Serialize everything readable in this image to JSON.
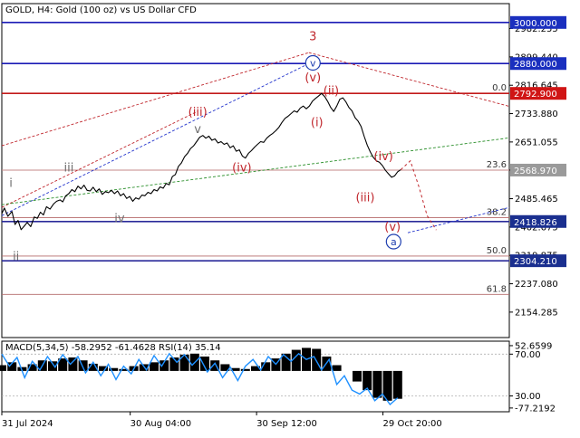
{
  "chart_data": {
    "type": "line",
    "title": "GOLD, H4:  Gold (100 oz) vs US Dollar CFD",
    "price_axis": {
      "ylim": [
        2080,
        3055
      ],
      "ticks": [
        "2982.255",
        "2899.440",
        "2816.645",
        "2733.880",
        "2651.055",
        "2568.970",
        "2485.465",
        "2402.675",
        "2319.875",
        "2237.080",
        "2154.285"
      ],
      "tick_values": [
        2982.255,
        2899.44,
        2816.645,
        2733.88,
        2651.055,
        2568.97,
        2485.465,
        2402.675,
        2319.875,
        2237.08,
        2154.285
      ]
    },
    "x_labels": [
      "31 Jul 2024",
      "30 Aug 04:00",
      "30 Sep 12:00",
      "29 Oct 20:00"
    ],
    "x_range": [
      0,
      100
    ],
    "x_label_positions": [
      0,
      25.3,
      50.2,
      75.1
    ],
    "levels": [
      {
        "name": "level-3000",
        "value": 3000.0,
        "label": "3000.000",
        "color": "#1a1ab5",
        "box": "#1a2fbf"
      },
      {
        "name": "level-2880",
        "value": 2880.0,
        "label": "2880.000",
        "color": "#1a1ab5",
        "box": "#1a2fbf"
      },
      {
        "name": "level-2792",
        "value": 2792.9,
        "label": "2792.900",
        "color": "#c21a1a",
        "box": "#d01515"
      },
      {
        "name": "level-2568",
        "value": 2568.97,
        "label": "2568.970",
        "color": "#c48a8a",
        "box": "#9a9a9a"
      },
      {
        "name": "level-2418",
        "value": 2418.826,
        "label": "2418.826",
        "color": "#2a2a9a",
        "box": "#1a2f8f"
      },
      {
        "name": "level-2304",
        "value": 2304.21,
        "label": "2304.210",
        "color": "#2a2a9a",
        "box": "#1a2f8f"
      }
    ],
    "fib_lines": [
      {
        "label": "0.0",
        "value": 2792.9
      },
      {
        "label": "23.6",
        "value": 2568.97
      },
      {
        "label": "38.2",
        "value": 2430.0
      },
      {
        "label": "50.0",
        "value": 2318.0
      },
      {
        "label": "61.8",
        "value": 2206.0
      }
    ],
    "price_series": [
      [
        0,
        2442
      ],
      [
        0.5,
        2458
      ],
      [
        1.2,
        2434
      ],
      [
        2,
        2448
      ],
      [
        2.6,
        2410
      ],
      [
        3.2,
        2422
      ],
      [
        3.8,
        2395
      ],
      [
        4.4,
        2405
      ],
      [
        5,
        2416
      ],
      [
        5.7,
        2404
      ],
      [
        6.4,
        2432
      ],
      [
        7,
        2428
      ],
      [
        7.6,
        2446
      ],
      [
        8.2,
        2438
      ],
      [
        8.8,
        2462
      ],
      [
        9.5,
        2455
      ],
      [
        10.2,
        2470
      ],
      [
        10.8,
        2478
      ],
      [
        11.5,
        2482
      ],
      [
        12,
        2476
      ],
      [
        12.6,
        2494
      ],
      [
        13.2,
        2500
      ],
      [
        13.8,
        2512
      ],
      [
        14.4,
        2506
      ],
      [
        15,
        2522
      ],
      [
        15.6,
        2514
      ],
      [
        16.2,
        2525
      ],
      [
        16.8,
        2510
      ],
      [
        17.4,
        2508
      ],
      [
        18,
        2519
      ],
      [
        18.6,
        2506
      ],
      [
        19.2,
        2514
      ],
      [
        19.8,
        2498
      ],
      [
        20.4,
        2506
      ],
      [
        21,
        2503
      ],
      [
        21.6,
        2510
      ],
      [
        22.2,
        2500
      ],
      [
        22.8,
        2508
      ],
      [
        23.4,
        2494
      ],
      [
        24,
        2500
      ],
      [
        24.6,
        2486
      ],
      [
        25.2,
        2492
      ],
      [
        25.8,
        2478
      ],
      [
        26.4,
        2488
      ],
      [
        27,
        2484
      ],
      [
        27.6,
        2496
      ],
      [
        28.2,
        2494
      ],
      [
        28.8,
        2504
      ],
      [
        29.4,
        2500
      ],
      [
        30,
        2512
      ],
      [
        30.6,
        2508
      ],
      [
        31.2,
        2520
      ],
      [
        31.8,
        2516
      ],
      [
        32.4,
        2530
      ],
      [
        33,
        2526
      ],
      [
        33.6,
        2550
      ],
      [
        34.2,
        2556
      ],
      [
        34.8,
        2580
      ],
      [
        35.4,
        2590
      ],
      [
        36,
        2608
      ],
      [
        36.6,
        2618
      ],
      [
        37.2,
        2632
      ],
      [
        37.8,
        2640
      ],
      [
        38.4,
        2652
      ],
      [
        39,
        2665
      ],
      [
        39.6,
        2670
      ],
      [
        40.2,
        2662
      ],
      [
        40.8,
        2668
      ],
      [
        41.4,
        2656
      ],
      [
        42,
        2660
      ],
      [
        42.6,
        2648
      ],
      [
        43.2,
        2652
      ],
      [
        43.8,
        2644
      ],
      [
        44.4,
        2648
      ],
      [
        45,
        2634
      ],
      [
        45.6,
        2640
      ],
      [
        46.2,
        2624
      ],
      [
        46.8,
        2628
      ],
      [
        47.4,
        2610
      ],
      [
        48,
        2604
      ],
      [
        48.6,
        2618
      ],
      [
        49.2,
        2626
      ],
      [
        49.8,
        2636
      ],
      [
        50.4,
        2644
      ],
      [
        51,
        2652
      ],
      [
        51.6,
        2650
      ],
      [
        52.2,
        2662
      ],
      [
        52.8,
        2670
      ],
      [
        53.4,
        2676
      ],
      [
        54,
        2684
      ],
      [
        54.6,
        2694
      ],
      [
        55.2,
        2708
      ],
      [
        55.8,
        2720
      ],
      [
        56.4,
        2726
      ],
      [
        57,
        2734
      ],
      [
        57.6,
        2742
      ],
      [
        58.2,
        2738
      ],
      [
        58.8,
        2750
      ],
      [
        59.4,
        2756
      ],
      [
        60,
        2748
      ],
      [
        60.6,
        2756
      ],
      [
        61.2,
        2770
      ],
      [
        61.8,
        2778
      ],
      [
        62.4,
        2785
      ],
      [
        63,
        2792.9
      ],
      [
        63.6,
        2784
      ],
      [
        64.2,
        2770
      ],
      [
        64.8,
        2752
      ],
      [
        65.4,
        2740
      ],
      [
        66,
        2756
      ],
      [
        66.6,
        2776
      ],
      [
        67.2,
        2780
      ],
      [
        67.8,
        2768
      ],
      [
        68.4,
        2752
      ],
      [
        69,
        2742
      ],
      [
        69.6,
        2722
      ],
      [
        70.2,
        2712
      ],
      [
        70.8,
        2696
      ],
      [
        71.4,
        2668
      ],
      [
        72,
        2642
      ],
      [
        72.6,
        2622
      ],
      [
        73.2,
        2606
      ],
      [
        73.8,
        2596
      ],
      [
        74.4,
        2592
      ],
      [
        75,
        2582
      ],
      [
        75.6,
        2568
      ],
      [
        76.2,
        2558
      ],
      [
        76.8,
        2548
      ],
      [
        77.4,
        2552
      ],
      [
        78,
        2564
      ],
      [
        78.6,
        2570
      ]
    ],
    "projection": [
      [
        78.6,
        2570
      ],
      [
        80.5,
        2596
      ],
      [
        82.2,
        2520
      ],
      [
        83.8,
        2436
      ],
      [
        85.6,
        2394
      ]
    ],
    "trend_lines": [
      {
        "name": "red-channel-top",
        "color": "#c0272d",
        "dash": "3,2",
        "points": [
          [
            0,
            2640
          ],
          [
            60.5,
            2912
          ]
        ]
      },
      {
        "name": "red-channel-from-top",
        "color": "#c0272d",
        "dash": "3,2",
        "points": [
          [
            60.5,
            2912
          ],
          [
            100,
            2755
          ]
        ]
      },
      {
        "name": "red-channel-lower",
        "color": "#c0272d",
        "dash": "3,2",
        "points": [
          [
            0,
            2460
          ],
          [
            38.5,
            2740
          ]
        ]
      },
      {
        "name": "blue-channel",
        "color": "#2233cc",
        "dash": "3,2",
        "points": [
          [
            0,
            2436
          ],
          [
            60.5,
            2880
          ]
        ]
      },
      {
        "name": "green-channel",
        "color": "#2a8f2a",
        "dash": "3,2",
        "points": [
          [
            0,
            2468
          ],
          [
            100,
            2663
          ]
        ]
      },
      {
        "name": "blue-channel-lower",
        "color": "#2233cc",
        "dash": "3,2",
        "points": [
          [
            80,
            2386
          ],
          [
            100,
            2460
          ]
        ]
      }
    ],
    "wave_labels": [
      {
        "text": "3",
        "x": 61.3,
        "y": 2958,
        "style": "red",
        "circled": false
      },
      {
        "text": "v",
        "x": 61.3,
        "y": 2882,
        "style": "navy",
        "circled": true
      },
      {
        "text": "(v)",
        "x": 61.3,
        "y": 2838,
        "style": "red",
        "circled": false
      },
      {
        "text": "(ii)",
        "x": 64.9,
        "y": 2800,
        "style": "red",
        "circled": false
      },
      {
        "text": "(i)",
        "x": 62.1,
        "y": 2707,
        "style": "red",
        "circled": false
      },
      {
        "text": "(iv)",
        "x": 75.2,
        "y": 2608,
        "style": "red",
        "circled": false
      },
      {
        "text": "(iii)",
        "x": 71.6,
        "y": 2488,
        "style": "red",
        "circled": false
      },
      {
        "text": "(v)",
        "x": 77,
        "y": 2402,
        "style": "red",
        "circled": false
      },
      {
        "text": "a",
        "x": 77.2,
        "y": 2360,
        "style": "navy",
        "circled": true
      },
      {
        "text": "(iii)",
        "x": 38.6,
        "y": 2738,
        "style": "red",
        "circled": false
      },
      {
        "text": "(iv)",
        "x": 47.3,
        "y": 2575,
        "style": "red",
        "circled": false
      },
      {
        "text": "iii",
        "x": 13.2,
        "y": 2575,
        "style": "gray",
        "circled": false
      },
      {
        "text": "v",
        "x": 38.6,
        "y": 2688,
        "style": "gray",
        "circled": false
      },
      {
        "text": "iv",
        "x": 23.2,
        "y": 2428,
        "style": "gray",
        "circled": false
      },
      {
        "text": "i",
        "x": 1.8,
        "y": 2530,
        "style": "gray",
        "circled": false
      },
      {
        "text": "ii",
        "x": 2.8,
        "y": 2317,
        "style": "gray",
        "circled": false
      }
    ],
    "indicator": {
      "label": "MACD(5,34,5) -58.2952 -61.4628 RSI(14) 35.14",
      "ticks": [
        "52.6599",
        "70.00",
        "30.00",
        "-77.2192"
      ],
      "tick_values": [
        52.6599,
        35.0,
        -52.0,
        -77.2192
      ],
      "ylim": [
        -85,
        62
      ],
      "macd": [
        [
          0,
          12
        ],
        [
          2,
          18
        ],
        [
          4,
          8
        ],
        [
          6,
          14
        ],
        [
          8,
          22
        ],
        [
          10,
          20
        ],
        [
          12,
          26
        ],
        [
          14,
          28
        ],
        [
          16,
          22
        ],
        [
          18,
          15
        ],
        [
          20,
          10
        ],
        [
          22,
          6
        ],
        [
          24,
          4
        ],
        [
          26,
          10
        ],
        [
          28,
          14
        ],
        [
          30,
          18
        ],
        [
          32,
          22
        ],
        [
          34,
          28
        ],
        [
          36,
          34
        ],
        [
          38,
          36
        ],
        [
          40,
          30
        ],
        [
          42,
          22
        ],
        [
          44,
          14
        ],
        [
          46,
          6
        ],
        [
          48,
          4
        ],
        [
          50,
          10
        ],
        [
          52,
          18
        ],
        [
          54,
          26
        ],
        [
          56,
          36
        ],
        [
          58,
          44
        ],
        [
          60,
          48
        ],
        [
          62,
          46
        ],
        [
          64,
          30
        ],
        [
          66,
          12
        ],
        [
          68,
          0
        ],
        [
          70,
          -22
        ],
        [
          72,
          -40
        ],
        [
          74,
          -56
        ],
        [
          76,
          -62
        ],
        [
          78,
          -58
        ]
      ],
      "rsi": [
        [
          0,
          35
        ],
        [
          1.5,
          10
        ],
        [
          3,
          28
        ],
        [
          4.5,
          -14
        ],
        [
          6,
          20
        ],
        [
          7.5,
          2
        ],
        [
          9,
          30
        ],
        [
          10.5,
          8
        ],
        [
          12,
          34
        ],
        [
          13.5,
          14
        ],
        [
          15,
          30
        ],
        [
          16.5,
          -4
        ],
        [
          18,
          18
        ],
        [
          19.5,
          -10
        ],
        [
          21,
          14
        ],
        [
          22.5,
          -18
        ],
        [
          24,
          10
        ],
        [
          25.5,
          -6
        ],
        [
          27,
          24
        ],
        [
          28.5,
          2
        ],
        [
          30,
          32
        ],
        [
          31.5,
          10
        ],
        [
          33,
          36
        ],
        [
          34.5,
          18
        ],
        [
          36,
          34
        ],
        [
          37.5,
          12
        ],
        [
          39,
          28
        ],
        [
          40.5,
          -2
        ],
        [
          42,
          16
        ],
        [
          43.5,
          -14
        ],
        [
          45,
          8
        ],
        [
          46.5,
          -20
        ],
        [
          48,
          10
        ],
        [
          49.5,
          24
        ],
        [
          51,
          2
        ],
        [
          52.5,
          30
        ],
        [
          54,
          14
        ],
        [
          55.5,
          34
        ],
        [
          57,
          20
        ],
        [
          58.5,
          36
        ],
        [
          60,
          24
        ],
        [
          61.5,
          30
        ],
        [
          63,
          2
        ],
        [
          64.5,
          24
        ],
        [
          66,
          -28
        ],
        [
          67.5,
          -10
        ],
        [
          69,
          -40
        ],
        [
          70.5,
          -48
        ],
        [
          72,
          -36
        ],
        [
          73.5,
          -62
        ],
        [
          75,
          -48
        ],
        [
          76.5,
          -70
        ],
        [
          78,
          -56
        ]
      ]
    },
    "colors": {
      "price": "#000000",
      "rsi": "#1e90ff",
      "macd": "#000000",
      "grid": "#d6d6d6"
    }
  }
}
